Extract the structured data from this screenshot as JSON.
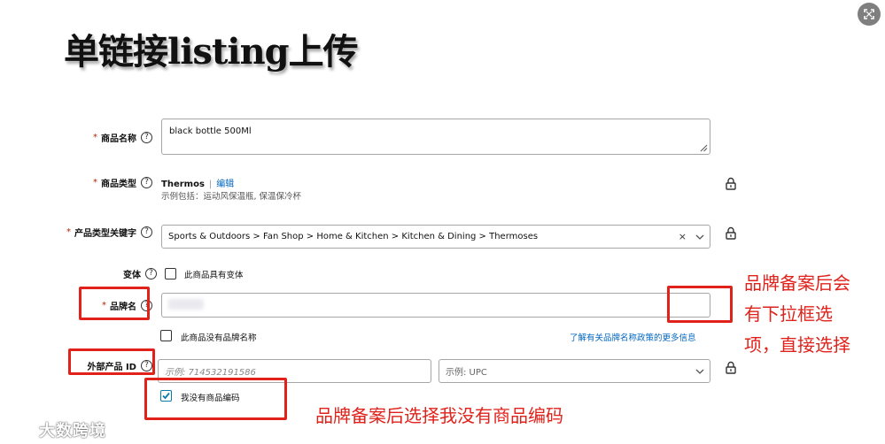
{
  "slide": {
    "title": "单链接listing上传"
  },
  "fields": {
    "item_name": {
      "label": "商品名称",
      "value": "black bottle 500Ml"
    },
    "product_type": {
      "label": "商品类型",
      "name": "Thermos",
      "separator": "|",
      "edit": "编辑",
      "hint": "示例包括：运动风保温瓶, 保温保冷杯"
    },
    "type_keyword": {
      "label": "产品类型关键字",
      "value": "Sports & Outdoors > Fan Shop > Home & Kitchen > Kitchen & Dining > Thermoses",
      "clear": "×"
    },
    "variation": {
      "label": "变体",
      "checkbox_label": "此商品具有变体",
      "checked": false
    },
    "brand": {
      "label": "品牌名",
      "no_brand_label": "此商品没有品牌名称",
      "no_brand_checked": false,
      "policy_link": "了解有关品牌名称政策的更多信息"
    },
    "external_id": {
      "label": "外部产品 ID",
      "id_placeholder": "示例:  714532191586",
      "type_placeholder": "示例:  UPC",
      "no_code_label": "我没有商品编码",
      "no_code_checked": true
    }
  },
  "required_mark": "*",
  "help_glyph": "?",
  "annotations": {
    "brand_note_lines": [
      "品牌备案后会",
      "有下拉框选",
      "项，直接选择"
    ],
    "bottom_note": "品牌备案后选择我没有商品编码"
  },
  "watermark": {
    "text": "大数跨境"
  },
  "colors": {
    "annotation_red": "#e0221b",
    "link_blue": "#0066c0",
    "required_red": "#b12704"
  }
}
